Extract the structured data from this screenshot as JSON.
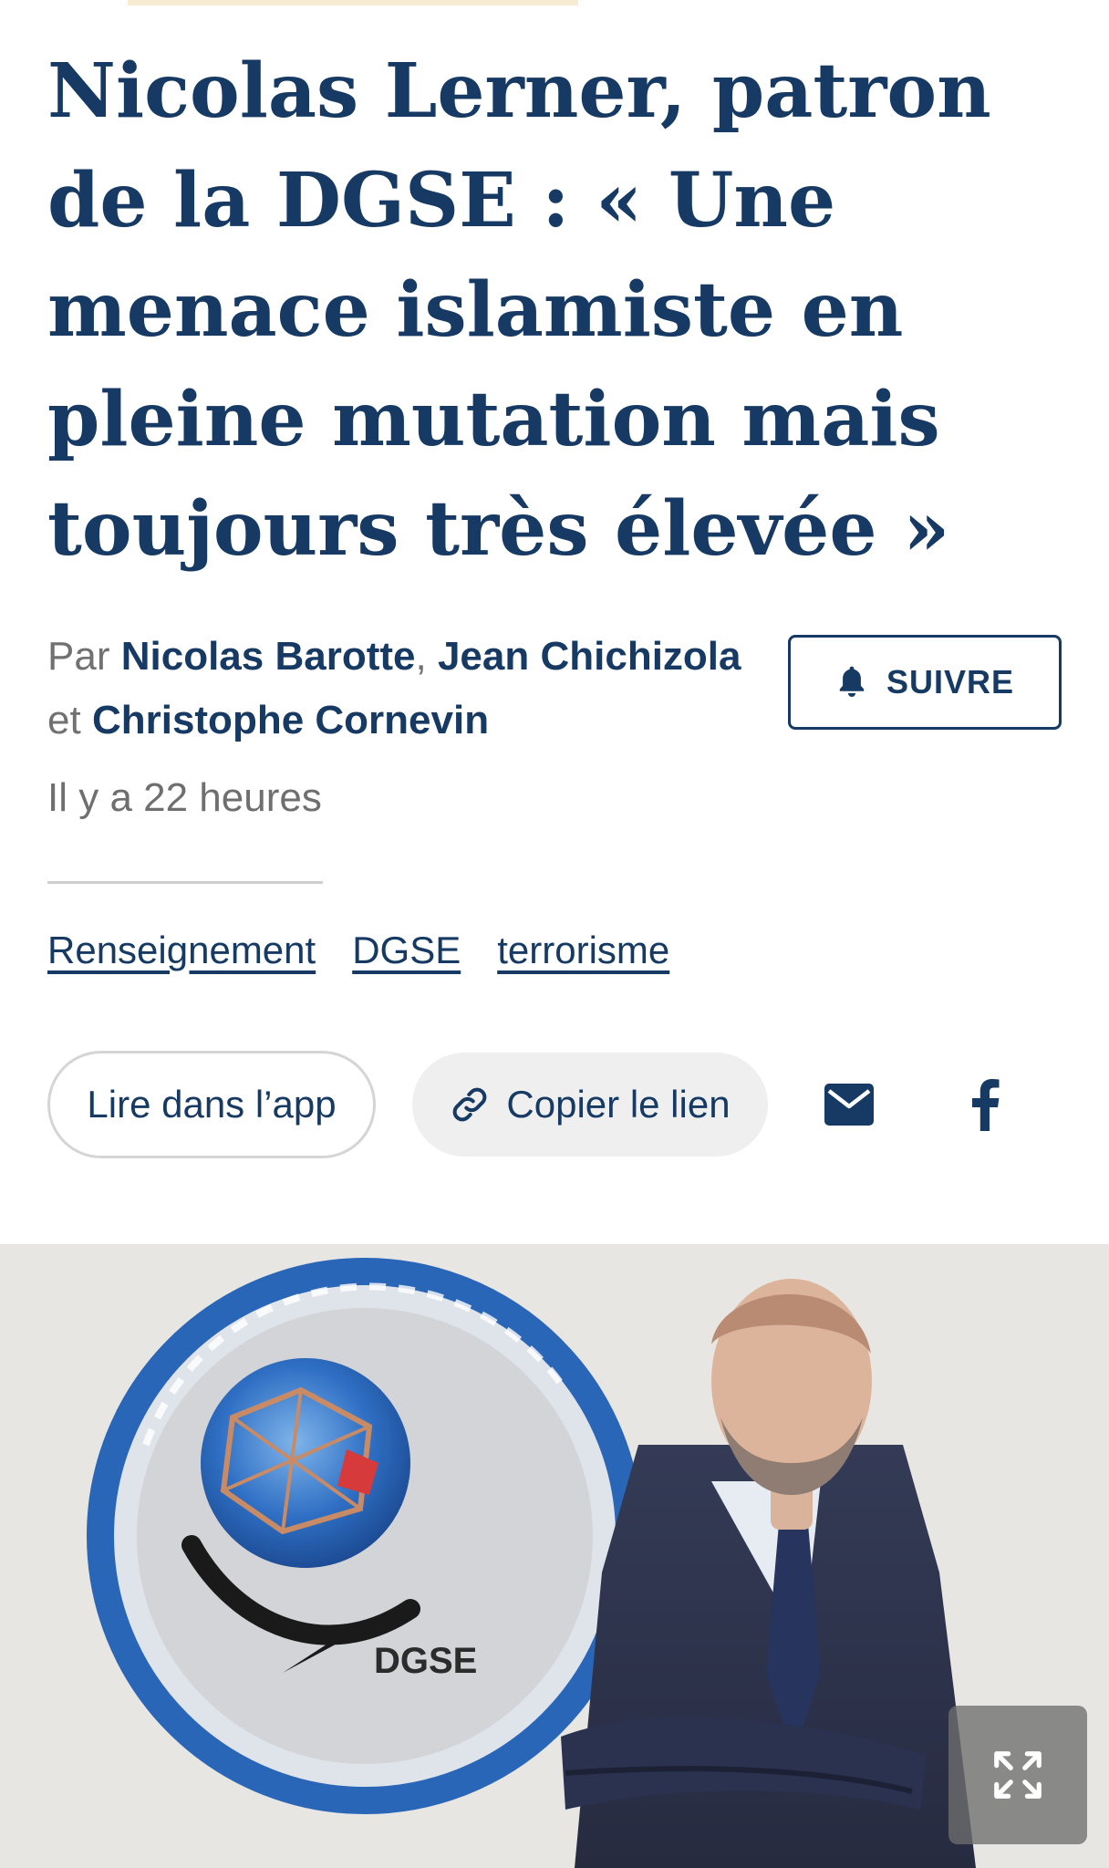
{
  "article": {
    "title": "Nicolas Lerner, patron de la DGSE : « Une menace islamiste en pleine mutation mais toujours très élevée »",
    "byline": {
      "prefix": "Par",
      "authors": [
        "Nicolas Barotte",
        "Jean Chichizola",
        "Christophe Cornevin"
      ],
      "separator_comma": ",",
      "separator_and": "et"
    },
    "follow_label": "SUIVRE",
    "time_ago": "Il y a 22 heures",
    "tags": [
      "Renseignement",
      "DGSE",
      "terrorisme"
    ]
  },
  "share": {
    "read_in_app_label": "Lire dans l’app",
    "copy_link_label": "Copier le lien",
    "email_icon": "envelope-icon",
    "facebook_icon": "facebook-icon"
  },
  "photo": {
    "emblem_text": "DGSE",
    "expand_icon": "expand-icon"
  },
  "colors": {
    "brand_navy": "#163a63",
    "muted_gray": "#717171",
    "pill_gray": "#efefef"
  }
}
